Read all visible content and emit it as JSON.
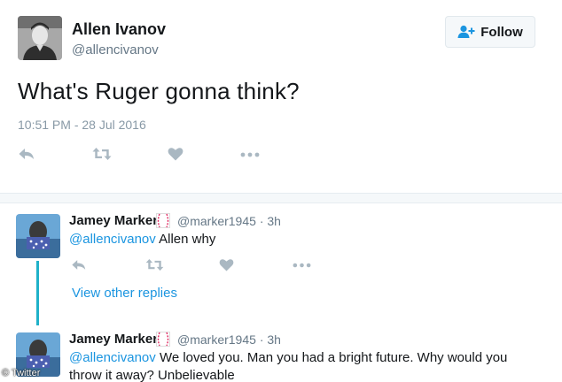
{
  "main_tweet": {
    "name": "Allen Ivanov",
    "handle": "@allencivanov",
    "text": "What's Ruger gonna think?",
    "timestamp": "10:51 PM - 28 Jul 2016",
    "follow_label": "Follow",
    "icons": [
      "reply-icon",
      "retweet-icon",
      "like-icon",
      "more-icon"
    ]
  },
  "replies": [
    {
      "name": "Jamey Marker",
      "handle": "@marker1945",
      "time": "3h",
      "separator": "·",
      "mention": "@allencivanov",
      "text": " Allen why"
    },
    {
      "name": "Jamey Marker",
      "handle": "@marker1945",
      "time": "3h",
      "separator": "·",
      "mention": "@allencivanov",
      "text": " We loved you. Man you had a bright future. Why would you",
      "text_line2": "throw it away? Unbelievable"
    }
  ],
  "view_other_replies": "View other replies",
  "watermark": "© Twitter",
  "colors": {
    "link": "#1b95e0",
    "thread_line": "#1fb1c9",
    "icon_gray": "#aab8c2",
    "badge_red": "#e0245e"
  }
}
